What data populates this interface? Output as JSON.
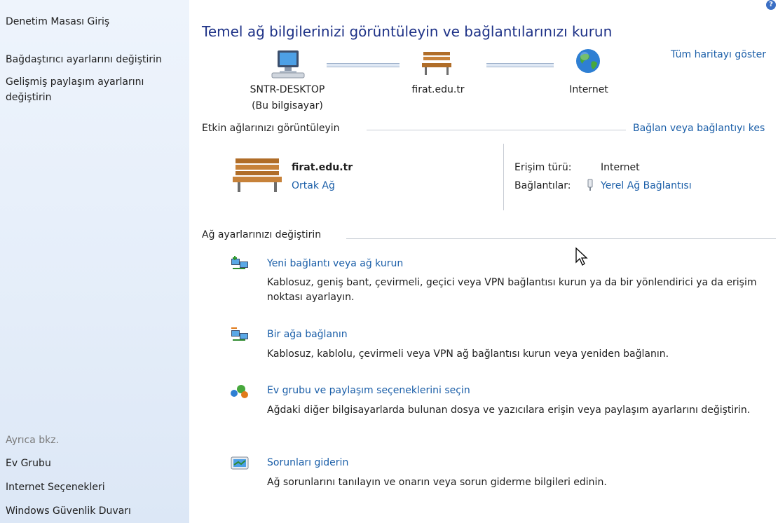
{
  "sidebar": {
    "home_label": "Denetim Masası Giriş",
    "links": [
      {
        "label": "Bağdaştırıcı ayarlarını değiştirin"
      },
      {
        "label": "Gelişmiş paylaşım ayarlarını değiştirin"
      }
    ],
    "see_also_title": "Ayrıca bkz.",
    "see_also": [
      {
        "label": "Ev Grubu"
      },
      {
        "label": "Internet Seçenekleri"
      },
      {
        "label": "Windows Güvenlik Duvarı"
      }
    ]
  },
  "main": {
    "title": "Temel ağ bilgilerinizi görüntüleyin ve bağlantılarınızı kurun",
    "full_map_link": "Tüm haritayı göster",
    "map": {
      "computer_name": "SNTR-DESKTOP",
      "computer_sub": "(Bu bilgisayar)",
      "network_name": "firat.edu.tr",
      "internet_label": "Internet"
    },
    "active_networks": {
      "heading": "Etkin ağlarınızı görüntüleyin",
      "connect_link": "Bağlan veya bağlantıyı kes",
      "network_name": "firat.edu.tr",
      "network_type": "Ortak Ağ",
      "access_type_label": "Erişim türü:",
      "access_type_value": "Internet",
      "connections_label": "Bağlantılar:",
      "connections_value": "Yerel Ağ Bağlantısı"
    },
    "change_settings": {
      "heading": "Ağ ayarlarınızı değiştirin",
      "tasks": [
        {
          "icon": "new-connection-icon",
          "title": "Yeni bağlantı veya ağ kurun",
          "desc": "Kablosuz, geniş bant, çevirmeli, geçici veya VPN bağlantısı kurun ya da bir yönlendirici ya da erişim noktası ayarlayın."
        },
        {
          "icon": "connect-network-icon",
          "title": "Bir ağa bağlanın",
          "desc": "Kablosuz, kablolu, çevirmeli veya VPN ağ bağlantısı kurun veya yeniden bağlanın."
        },
        {
          "icon": "homegroup-icon",
          "title": "Ev grubu ve paylaşım seçeneklerini seçin",
          "desc": "Ağdaki diğer bilgisayarlarda bulunan dosya ve yazıcılara erişin veya paylaşım ayarlarını değiştirin."
        },
        {
          "icon": "troubleshoot-icon",
          "title": "Sorunları giderin",
          "desc": "Ağ sorunlarını tanılayın ve onarın veya sorun giderme bilgileri edinin."
        }
      ]
    }
  },
  "colors": {
    "link": "#1a5ea8",
    "title": "#1e3287",
    "sidebar_bg": "#e4edf9"
  }
}
